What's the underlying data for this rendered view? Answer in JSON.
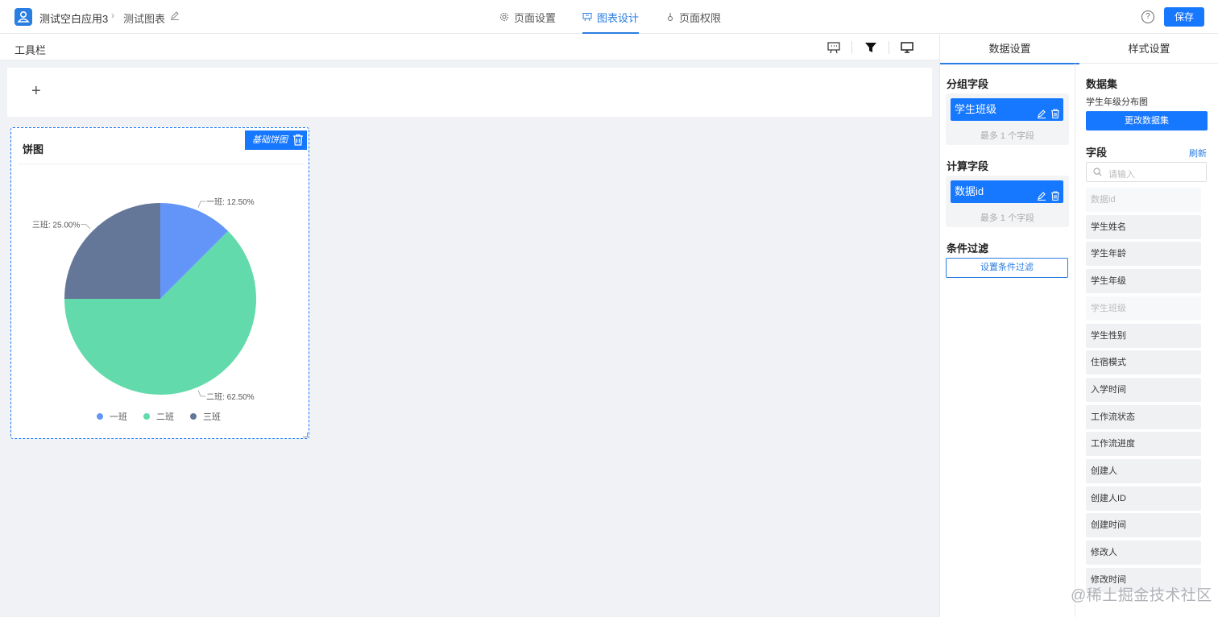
{
  "header": {
    "app_name": "测试空白应用3",
    "chart_name": "测试图表",
    "tabs": [
      {
        "label": "页面设置",
        "active": false
      },
      {
        "label": "图表设计",
        "active": true
      },
      {
        "label": "页面权限",
        "active": false
      }
    ],
    "help_symbol": "?",
    "save_label": "保存"
  },
  "toolbar": {
    "title": "工具栏",
    "icons": [
      "presentation-icon",
      "filter-icon",
      "monitor-icon"
    ]
  },
  "canvas": {
    "add_symbol": "+",
    "chart_card": {
      "title": "饼图",
      "badge": "基础饼图"
    }
  },
  "chart_data": {
    "type": "pie",
    "categories": [
      "一班",
      "二班",
      "三班"
    ],
    "values": [
      12.5,
      62.5,
      25.0
    ],
    "labels": [
      "一班: 12.50%",
      "二班: 62.50%",
      "三班: 25.00%"
    ],
    "colors": [
      "#6395f9",
      "#62daab",
      "#657798"
    ],
    "legend": "bottom"
  },
  "right_panel": {
    "tabs": [
      {
        "label": "数据设置",
        "active": true
      },
      {
        "label": "样式设置",
        "active": false
      }
    ],
    "group_field": {
      "title": "分组字段",
      "chip": "学生班级",
      "hint": "最多 1 个字段"
    },
    "calc_field": {
      "title": "计算字段",
      "chip": "数据id",
      "hint": "最多 1 个字段"
    },
    "condition": {
      "title": "条件过滤",
      "button": "设置条件过滤"
    },
    "dataset": {
      "title": "数据集",
      "name": "学生年级分布图",
      "button": "更改数据集"
    },
    "fields": {
      "title": "字段",
      "refresh": "刷新",
      "search_placeholder": "请输入",
      "items": [
        {
          "label": "数据id",
          "disabled": true
        },
        {
          "label": "学生姓名",
          "disabled": false
        },
        {
          "label": "学生年龄",
          "disabled": false
        },
        {
          "label": "学生年级",
          "disabled": false
        },
        {
          "label": "学生班级",
          "disabled": true
        },
        {
          "label": "学生性别",
          "disabled": false
        },
        {
          "label": "住宿模式",
          "disabled": false
        },
        {
          "label": "入学时间",
          "disabled": false
        },
        {
          "label": "工作流状态",
          "disabled": false
        },
        {
          "label": "工作流进度",
          "disabled": false
        },
        {
          "label": "创建人",
          "disabled": false
        },
        {
          "label": "创建人ID",
          "disabled": false
        },
        {
          "label": "创建时间",
          "disabled": false
        },
        {
          "label": "修改人",
          "disabled": false
        },
        {
          "label": "修改时间",
          "disabled": false
        }
      ]
    }
  },
  "watermark": "@稀土掘金技术社区"
}
